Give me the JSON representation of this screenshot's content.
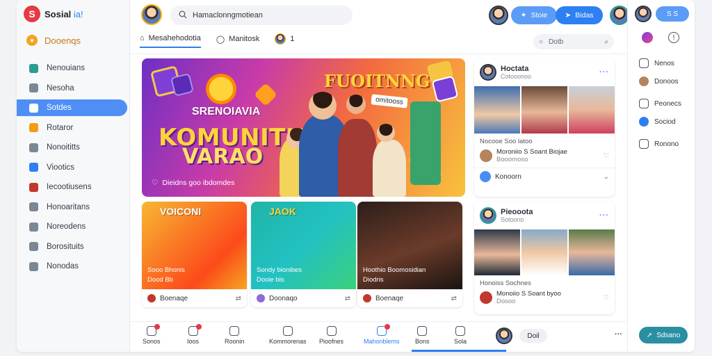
{
  "app": {
    "brand": "Sosial",
    "brand_suffix": "ia!",
    "logo_letter": "S"
  },
  "sidebar": {
    "primary": "Dooenqs",
    "items": [
      {
        "label": "Nenouians",
        "icon": "photo-icon",
        "color": "#2a9d8f"
      },
      {
        "label": "Nesoha",
        "icon": "image-icon",
        "color": "#7b8794"
      },
      {
        "label": "Sotdes",
        "icon": "bookmark-icon",
        "color": "#e53945"
      },
      {
        "label": "Rotaror",
        "icon": "list-icon",
        "color": "#f39c12"
      },
      {
        "label": "Nonoititts",
        "icon": "folder-icon",
        "color": "#7b8794"
      },
      {
        "label": "Viootics",
        "icon": "user-icon",
        "color": "#2d7ff2"
      },
      {
        "label": "Iecootiusens",
        "icon": "avatar-icon",
        "color": "#c0392b"
      },
      {
        "label": "Honoaritans",
        "icon": "document-icon",
        "color": "#7b8794"
      },
      {
        "label": "Noreodens",
        "icon": "calendar-icon",
        "color": "#7b8794"
      },
      {
        "label": "Borosituits",
        "icon": "badge-icon",
        "color": "#7b8794"
      },
      {
        "label": "Nonodas",
        "icon": "settings-icon",
        "color": "#7b8794"
      }
    ],
    "active_index": 2
  },
  "header": {
    "search_value": "Hamaclonngmotiean",
    "btn_primary": "Stoie",
    "btn_secondary": "Bidas",
    "tabs": [
      {
        "label": "Mesahehodotia"
      },
      {
        "label": "Manitosk"
      },
      {
        "label": "1"
      }
    ],
    "filter_label": "Dotb"
  },
  "banner": {
    "headline": "FUOITNNG",
    "tag": "omitooss",
    "title_top": "SRENOIAVIA",
    "title_main": "KOMUNITIAS",
    "title_sub": "VARAO",
    "caption": "Dieidns goo ibdomdes"
  },
  "cards": [
    {
      "title": "VOICONI",
      "cap1": "Sooo Bhonis",
      "cap2": "Dood Bb",
      "author": "Boenaqe",
      "bg": "linear-gradient(135deg,#f7b733,#fc4a1a 70%,#f5a623)"
    },
    {
      "title": "JAOK",
      "cap1": "Sondy bionibes",
      "cap2": "Dooie bis",
      "author": "Doonaqo",
      "bg": "linear-gradient(135deg,#1fb5a6,#22c1c3 50%,#3bd07c)"
    },
    {
      "title": "",
      "cap1": "Hoothio Boomosidian",
      "cap2": "Diodris",
      "author": "Boenaqe",
      "bg": "linear-gradient(160deg,#2d1f1a,#6b3b2a 55%,#1a1410)"
    }
  ],
  "feed": [
    {
      "name": "Hoctata",
      "sub": "Cotooonoo",
      "label": "Nocooe Soo latoo",
      "commenter": "Moroniio S Soant Biojae",
      "commenter_sub": "Booomoso",
      "action": "Konoorn"
    },
    {
      "name": "Pieooota",
      "sub": "Sotoono",
      "label": "Honoiss Sochnes",
      "commenter": "Monoiio S Soant byoo",
      "commenter_sub": "Dosoo",
      "action": ""
    }
  ],
  "bottom_tabs": [
    {
      "label": "Sonos",
      "active": false
    },
    {
      "label": "Ioos",
      "active": false
    },
    {
      "label": "Roonin",
      "active": false
    },
    {
      "label": "Kommorenas",
      "active": false
    },
    {
      "label": "Pioofnes",
      "active": false
    },
    {
      "label": "Mahonblems",
      "active": true
    },
    {
      "label": "Bons",
      "active": false
    },
    {
      "label": "Sola",
      "active": false
    },
    {
      "label": "Doil",
      "active": false
    }
  ],
  "rail": {
    "top_btn": "S S",
    "items": [
      {
        "label": "Nenos"
      },
      {
        "label": "Donoos"
      },
      {
        "label": "Peonecs"
      },
      {
        "label": "Sociod"
      },
      {
        "label": "Ronono"
      }
    ],
    "bottom_btn": "Sdsano"
  }
}
